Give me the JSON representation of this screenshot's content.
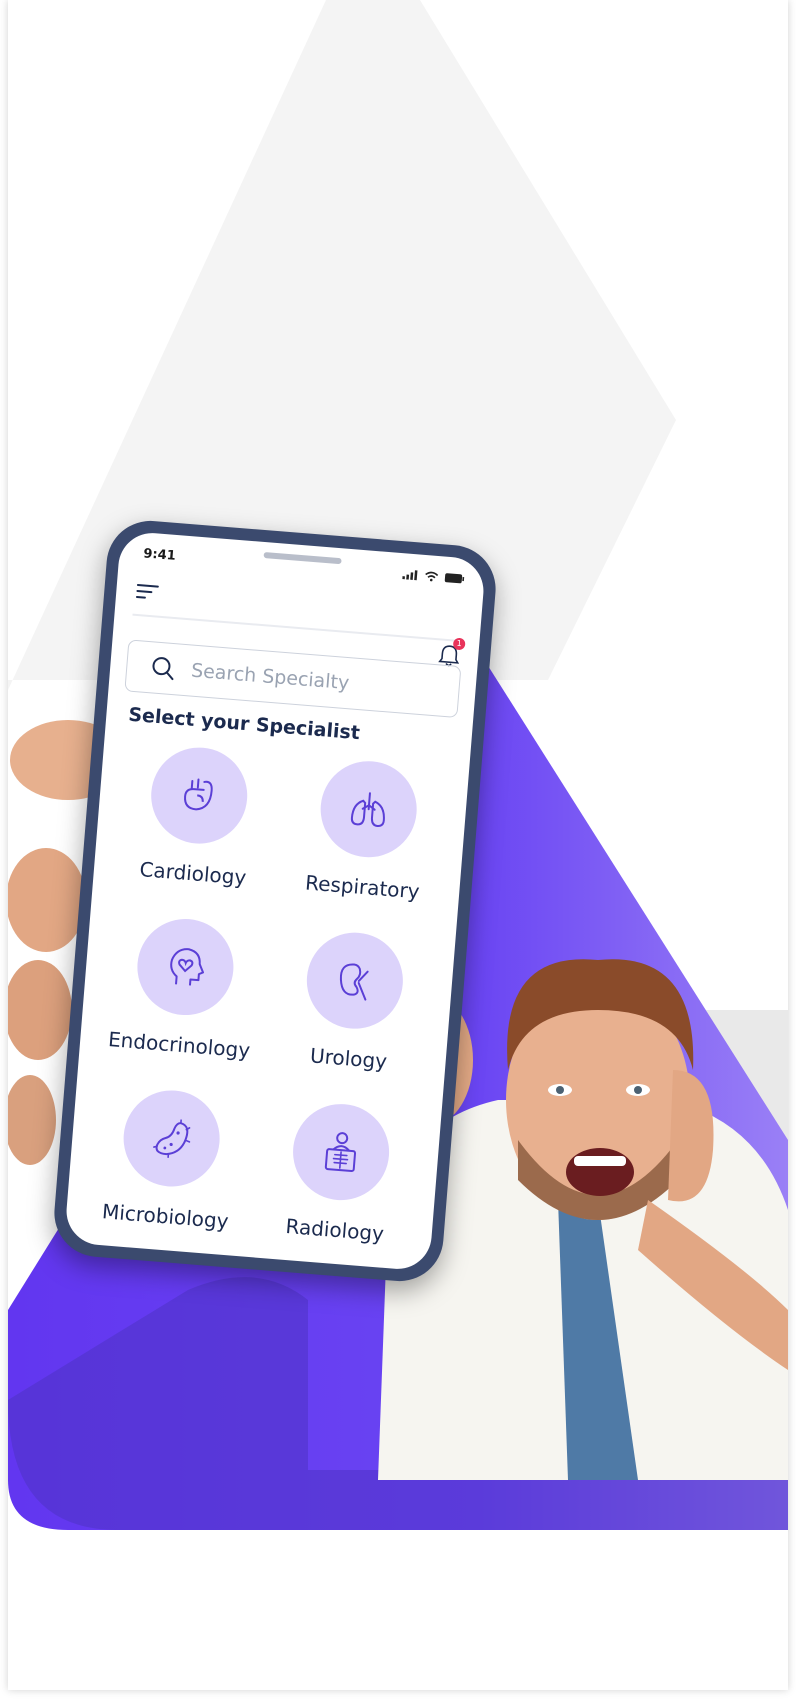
{
  "colors": {
    "accent": "#6b46f5",
    "accent_dark": "#4f33c4",
    "circle": "#dcd3fb",
    "badge": "#e8335a",
    "text_dark": "#1b2a4e"
  },
  "status_bar": {
    "time": "9:41"
  },
  "header": {
    "menu_icon": "hamburger-icon",
    "bell_icon": "bell-icon",
    "notification_count": "1"
  },
  "search": {
    "placeholder": "Search Specialty",
    "icon": "search-icon"
  },
  "section_title": "Select your Specialist",
  "specialties": [
    {
      "label": "Cardiology",
      "icon": "heart-organ-icon"
    },
    {
      "label": "Respiratory",
      "icon": "lungs-icon"
    },
    {
      "label": "Endocrinology",
      "icon": "head-heart-icon"
    },
    {
      "label": "Urology",
      "icon": "kidney-icon"
    },
    {
      "label": "Microbiology",
      "icon": "bacteria-icon"
    },
    {
      "label": "Radiology",
      "icon": "xray-icon"
    }
  ]
}
